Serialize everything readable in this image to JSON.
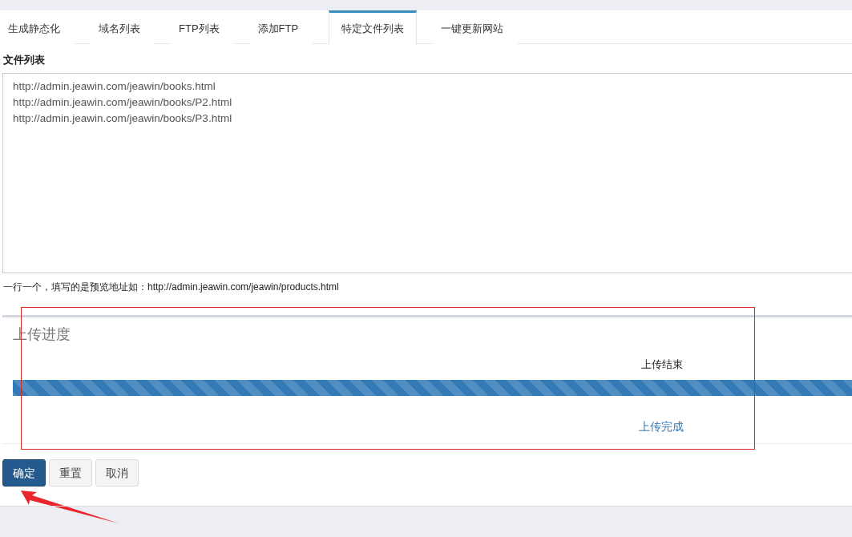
{
  "tabs": [
    {
      "label": "生成静态化",
      "selected": false
    },
    {
      "label": "域名列表",
      "selected": false
    },
    {
      "label": "FTP列表",
      "selected": false
    },
    {
      "label": "添加FTP",
      "selected": false
    },
    {
      "label": "特定文件列表",
      "selected": true
    },
    {
      "label": "一键更新网站",
      "selected": false
    }
  ],
  "file_list": {
    "label": "文件列表",
    "lines": [
      "http://admin.jeawin.com/jeawin/books.html",
      "http://admin.jeawin.com/jeawin/books/P2.html",
      "http://admin.jeawin.com/jeawin/books/P3.html"
    ],
    "hint": "一行一个，填写的是预览地址如：http://admin.jeawin.com/jeawin/products.html"
  },
  "upload": {
    "title": "上传进度",
    "status": "上传结束",
    "level": 1,
    "link": "上传完成"
  },
  "buttons": [
    {
      "label": "确定",
      "kind": "primary"
    },
    {
      "label": "重置",
      "kind": "default"
    },
    {
      "label": "取消",
      "kind": "default"
    }
  ]
}
